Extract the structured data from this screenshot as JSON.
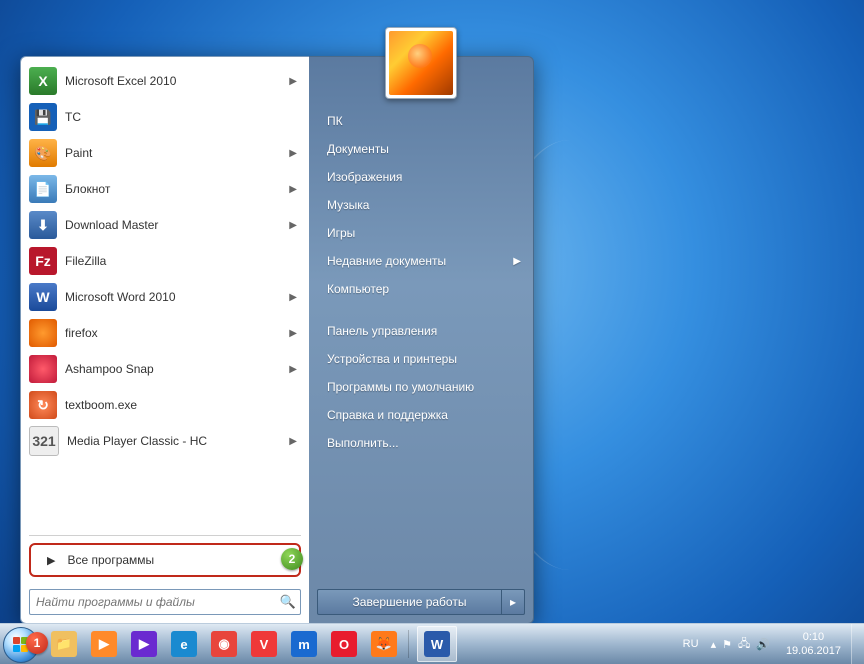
{
  "start_menu": {
    "programs": [
      {
        "name": "Microsoft Excel 2010",
        "icon": "excel",
        "has_sub": true
      },
      {
        "name": "TC",
        "icon": "tc",
        "has_sub": false
      },
      {
        "name": "Paint",
        "icon": "paint",
        "has_sub": true
      },
      {
        "name": "Блокнот",
        "icon": "notepad",
        "has_sub": true
      },
      {
        "name": "Download Master",
        "icon": "dm",
        "has_sub": true
      },
      {
        "name": "FileZilla",
        "icon": "filezilla",
        "has_sub": false
      },
      {
        "name": "Microsoft Word 2010",
        "icon": "word",
        "has_sub": true
      },
      {
        "name": "firefox",
        "icon": "firefox",
        "has_sub": true
      },
      {
        "name": "Ashampoo Snap",
        "icon": "ashampoo",
        "has_sub": true
      },
      {
        "name": "textboom.exe",
        "icon": "textboom",
        "has_sub": false
      },
      {
        "name": "Media Player Classic - HC",
        "icon": "mpc",
        "has_sub": true
      }
    ],
    "all_programs_label": "Все программы",
    "search_placeholder": "Найти программы и файлы",
    "right_items_top": [
      "ПК",
      "Документы",
      "Изображения",
      "Музыка",
      "Игры",
      "Недавние документы",
      "Компьютер"
    ],
    "right_items_bottom": [
      "Панель управления",
      "Устройства и принтеры",
      "Программы по умолчанию",
      "Справка и поддержка",
      "Выполнить..."
    ],
    "recent_docs_index": 5,
    "shutdown_label": "Завершение работы"
  },
  "taskbar": {
    "pinned": [
      {
        "name": "explorer",
        "glyph": "📁",
        "color": "#f0c060"
      },
      {
        "name": "wmp",
        "glyph": "▶",
        "color": "#ff8a2a"
      },
      {
        "name": "video",
        "glyph": "▶",
        "color": "#6a2ad0"
      },
      {
        "name": "ie",
        "glyph": "e",
        "color": "#1a8ad0"
      },
      {
        "name": "chrome",
        "glyph": "◉",
        "color": "#e8453c"
      },
      {
        "name": "vivaldi",
        "glyph": "V",
        "color": "#ef3939"
      },
      {
        "name": "maxthon",
        "glyph": "m",
        "color": "#1a6ad0"
      },
      {
        "name": "opera",
        "glyph": "O",
        "color": "#e81c2e"
      },
      {
        "name": "firefox",
        "glyph": "🦊",
        "color": "#ff7a1a"
      }
    ],
    "open": [
      {
        "name": "word",
        "glyph": "W",
        "color": "#2a5aaa"
      }
    ]
  },
  "tray": {
    "lang": "RU",
    "time": "0:10",
    "date": "19.06.2017"
  },
  "annotations": {
    "badge1": "1",
    "badge2": "2"
  },
  "icon_classes": {
    "excel": "ic-excel",
    "tc": "ic-tc",
    "paint": "ic-paint",
    "notepad": "ic-note",
    "dm": "ic-dm",
    "filezilla": "ic-fz",
    "word": "ic-word",
    "firefox": "ic-ff",
    "ashampoo": "ic-as",
    "textboom": "ic-tb",
    "mpc": "ic-mpc"
  },
  "icon_glyphs": {
    "excel": "X",
    "tc": "💾",
    "paint": "🎨",
    "notepad": "📄",
    "dm": "⬇",
    "filezilla": "Fz",
    "word": "W",
    "firefox": "",
    "ashampoo": "",
    "textboom": "↻",
    "mpc": "321"
  }
}
